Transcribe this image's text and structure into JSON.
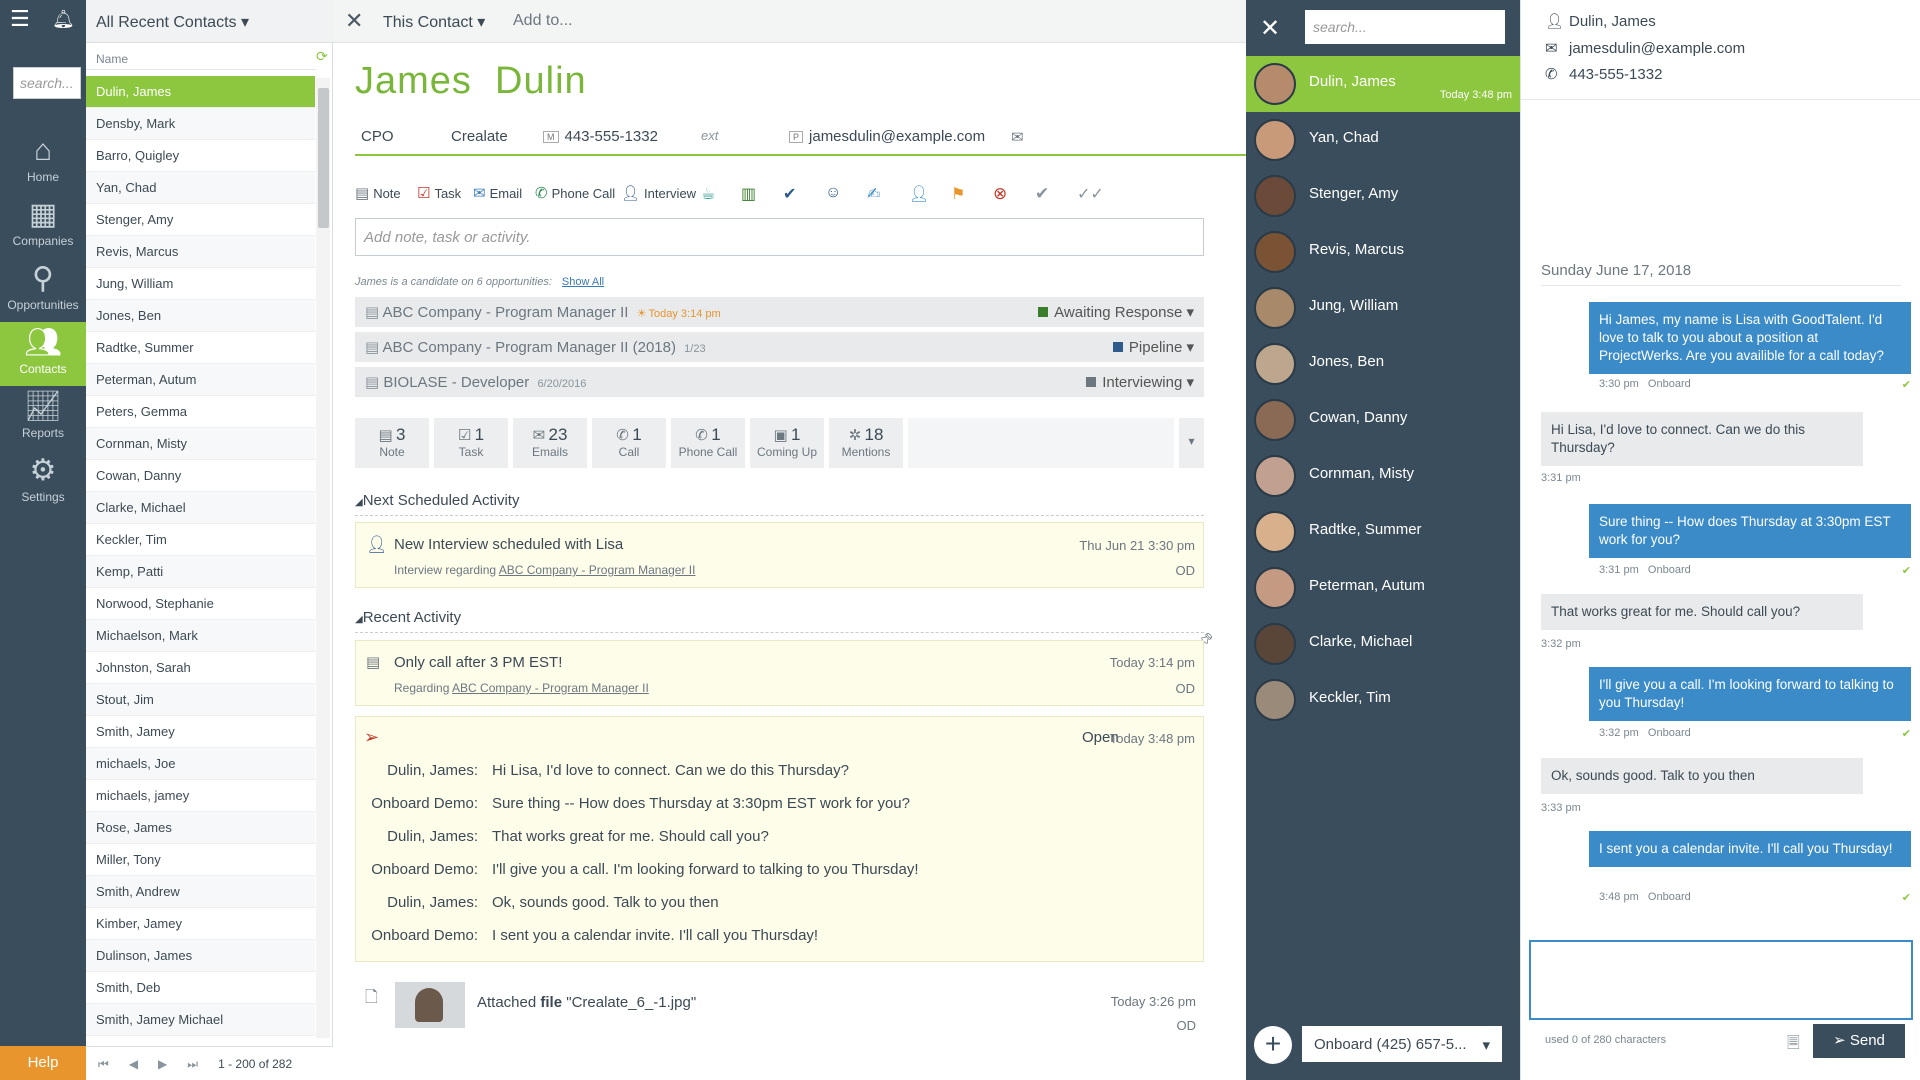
{
  "nav": {
    "search_placeholder": "search...",
    "items": [
      {
        "label": "Home",
        "icon": "home-icon"
      },
      {
        "label": "Companies",
        "icon": "companies-icon"
      },
      {
        "label": "Opportunities",
        "icon": "opportunities-icon"
      },
      {
        "label": "Contacts",
        "icon": "contacts-icon"
      },
      {
        "label": "Reports",
        "icon": "reports-icon"
      },
      {
        "label": "Settings",
        "icon": "settings-icon"
      }
    ],
    "help": "Help"
  },
  "list": {
    "title": "All Recent Contacts",
    "column": "Name",
    "rows": [
      "Dulin, James",
      "Densby, Mark",
      "Barro, Quigley",
      "Yan, Chad",
      "Stenger, Amy",
      "Revis, Marcus",
      "Jung, William",
      "Jones, Ben",
      "Radtke, Summer",
      "Peterman, Autum",
      "Peters, Gemma",
      "Cornman, Misty",
      "Cowan, Danny",
      "Clarke, Michael",
      "Keckler, Tim",
      "Kemp, Patti",
      "Norwood, Stephanie",
      "Michaelson, Mark",
      "Johnston, Sarah",
      "Stout, Jim",
      "Smith, Jamey",
      "michaels, Joe",
      "michaels, jamey",
      "Rose, James",
      "Miller, Tony",
      "Smith, Andrew",
      "Kimber, Jamey",
      "Dulinson, James",
      "Smith, Deb",
      "Smith, Jamey Michael"
    ],
    "pager": "1 - 200 of 282"
  },
  "main": {
    "topbar": {
      "scope": "This Contact",
      "add": "Add to..."
    },
    "first": "James",
    "last": "Dulin",
    "title": "CPO",
    "company": "Crealate",
    "phone_tag": "M",
    "phone": "443-555-1332",
    "ext": "ext",
    "email_tag": "P",
    "email": "jamesdulin@example.com",
    "actions": {
      "note": "Note",
      "task": "Task",
      "email": "Email",
      "phone": "Phone Call",
      "interview": "Interview"
    },
    "add_placeholder": "Add note, task or activity.",
    "candidate_text": "James is a candidate on 6 opportunities:",
    "show_all": "Show All",
    "opps": [
      {
        "name": "ABC Company - Program Manager II",
        "date": "Today 3:14 pm",
        "status": "Awaiting Response",
        "color": "#3a7d2a"
      },
      {
        "name": "ABC Company - Program Manager II (2018)",
        "date": "1/23",
        "status": "Pipeline",
        "color": "#2f5a8c"
      },
      {
        "name": "BIOLASE - Developer",
        "date": "6/20/2016",
        "status": "Interviewing",
        "color": "#6c7780"
      }
    ],
    "tiles": [
      {
        "n": "3",
        "l": "Note"
      },
      {
        "n": "1",
        "l": "Task"
      },
      {
        "n": "23",
        "l": "Emails"
      },
      {
        "n": "1",
        "l": "Call"
      },
      {
        "n": "1",
        "l": "Phone Call"
      },
      {
        "n": "1",
        "l": "Coming Up"
      },
      {
        "n": "18",
        "l": "Mentions"
      }
    ],
    "next_title": "Next Scheduled Activity",
    "next": {
      "title": "New Interview scheduled with Lisa",
      "sub": "Interview regarding",
      "link": "ABC Company - Program Manager II",
      "date": "Thu Jun 21 3:30 pm",
      "by": "OD"
    },
    "recent_title": "Recent Activity",
    "recent": {
      "title": "Only call after 3 PM EST!",
      "sub": "Regarding",
      "link": "ABC Company - Program Manager II",
      "date": "Today 3:14 pm",
      "by": "OD"
    },
    "sms": {
      "state": "Open",
      "date": "Today 3:48 pm",
      "lines": [
        {
          "who": "Dulin, James:",
          "text": "Hi Lisa, I'd love to connect. Can we do this Thursday?"
        },
        {
          "who": "Onboard Demo:",
          "text": "Sure thing -- How does Thursday at 3:30pm EST work for you?"
        },
        {
          "who": "Dulin, James:",
          "text": "That works great for me. Should call you?"
        },
        {
          "who": "Onboard Demo:",
          "text": "I'll give you a call. I'm looking forward to talking to you Thursday!"
        },
        {
          "who": "Dulin, James:",
          "text": "Ok, sounds good. Talk to you then"
        },
        {
          "who": "Onboard Demo:",
          "text": "I sent you a calendar invite. I'll call you Thursday!"
        }
      ]
    },
    "file": {
      "pre": "Attached",
      "bold": "file",
      "name": "\"Crealate_6_-1.jpg\"",
      "date": "Today 3:26 pm",
      "by": "OD"
    }
  },
  "chats": {
    "search_placeholder": "search...",
    "items": [
      {
        "name": "Dulin, James",
        "time": "Today 3:48 pm"
      },
      {
        "name": "Yan, Chad"
      },
      {
        "name": "Stenger, Amy"
      },
      {
        "name": "Revis, Marcus"
      },
      {
        "name": "Jung, William"
      },
      {
        "name": "Jones, Ben"
      },
      {
        "name": "Cowan, Danny"
      },
      {
        "name": "Cornman, Misty"
      },
      {
        "name": "Radtke, Summer"
      },
      {
        "name": "Peterman, Autum"
      },
      {
        "name": "Clarke, Michael"
      },
      {
        "name": "Keckler, Tim"
      }
    ],
    "from_number": "Onboard (425) 657-5..."
  },
  "conv": {
    "name": "Dulin, James",
    "email": "jamesdulin@example.com",
    "phone": "443-555-1332",
    "date": "Sunday June 17, 2018",
    "messages": [
      {
        "dir": "out",
        "text": "Hi James, my name is Lisa with GoodTalent. I'd love to talk to you about a position at ProjectWerks. Are you availible for a call today?",
        "time": "3:30 pm",
        "by": "Onboard"
      },
      {
        "dir": "in",
        "text": "Hi Lisa, I'd love to connect. Can we do this Thursday?",
        "time": "3:31 pm"
      },
      {
        "dir": "out",
        "text": "Sure thing -- How does Thursday at 3:30pm EST work for you?",
        "time": "3:31 pm",
        "by": "Onboard"
      },
      {
        "dir": "in",
        "text": "That works great for me. Should call you?",
        "time": "3:32 pm"
      },
      {
        "dir": "out",
        "text": "I'll give you a call. I'm looking forward to talking to you Thursday!",
        "time": "3:32 pm",
        "by": "Onboard"
      },
      {
        "dir": "in",
        "text": "Ok, sounds good. Talk to you then",
        "time": "3:33 pm"
      },
      {
        "dir": "out",
        "text": "I sent you a calendar invite. I'll call you Thursday!",
        "time": "3:48 pm",
        "by": "Onboard"
      }
    ],
    "used": "used 0 of 280 characters",
    "send": "Send"
  }
}
